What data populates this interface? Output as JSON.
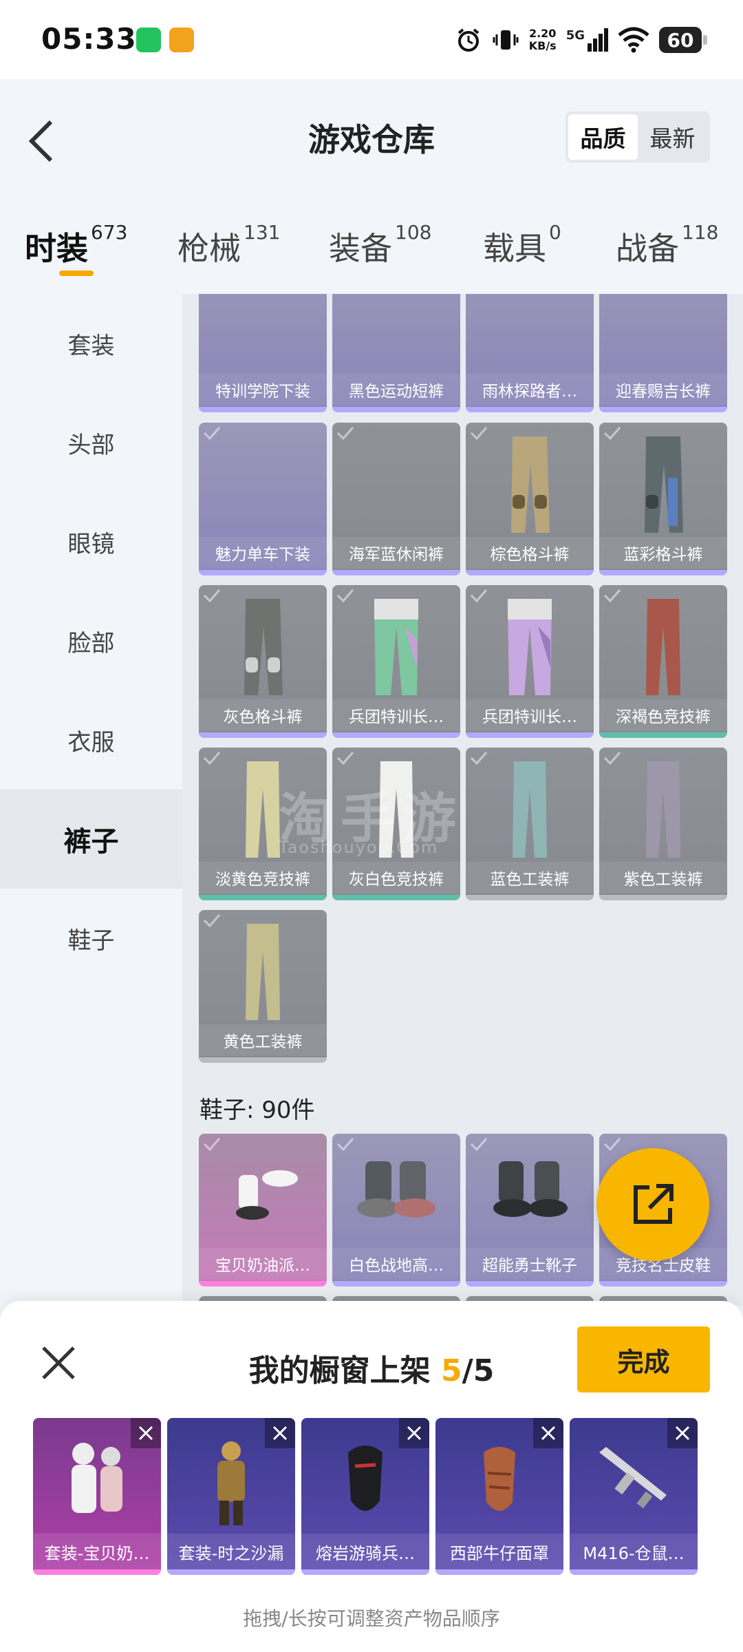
{
  "status": {
    "time": "05:33",
    "net_speed_value": "2.20",
    "net_speed_unit": "KB/s",
    "signal": "5G",
    "battery": "60"
  },
  "header": {
    "title": "游戏仓库",
    "sort_options": [
      "品质",
      "最新"
    ],
    "active_sort": "品质"
  },
  "tabs": [
    {
      "label": "时装",
      "count": "673"
    },
    {
      "label": "枪械",
      "count": "131"
    },
    {
      "label": "装备",
      "count": "108"
    },
    {
      "label": "载具",
      "count": "0"
    },
    {
      "label": "战备",
      "count": "118"
    }
  ],
  "sidebar": {
    "items": [
      "套装",
      "头部",
      "眼镜",
      "脸部",
      "衣服",
      "裤子",
      "鞋子"
    ],
    "active": "裤子"
  },
  "pants_items": [
    {
      "name": "特训学院下装",
      "rarity": "purple"
    },
    {
      "name": "黑色运动短裤",
      "rarity": "purple"
    },
    {
      "name": "雨林探路者…",
      "rarity": "purple"
    },
    {
      "name": "迎春赐吉长裤",
      "rarity": "purple"
    },
    {
      "name": "魅力单车下装",
      "rarity": "purple"
    },
    {
      "name": "海军蓝休闲裤",
      "rarity": "purple"
    },
    {
      "name": "棕色格斗裤",
      "rarity": "purple"
    },
    {
      "name": "蓝彩格斗裤",
      "rarity": "purple"
    },
    {
      "name": "灰色格斗裤",
      "rarity": "purple"
    },
    {
      "name": "兵团特训长…",
      "rarity": "purple"
    },
    {
      "name": "兵团特训长…",
      "rarity": "purple"
    },
    {
      "name": "深褐色竞技裤",
      "rarity": "teal"
    },
    {
      "name": "淡黄色竞技裤",
      "rarity": "teal"
    },
    {
      "name": "灰白色竞技裤",
      "rarity": "teal"
    },
    {
      "name": "蓝色工装裤",
      "rarity": "gray"
    },
    {
      "name": "紫色工装裤",
      "rarity": "gray"
    },
    {
      "name": "黄色工装裤",
      "rarity": "gray"
    }
  ],
  "shoes_section": {
    "title": "鞋子: 90件",
    "items": [
      {
        "name": "宝贝奶油派…",
        "rarity": "pink"
      },
      {
        "name": "白色战地高…",
        "rarity": "purple"
      },
      {
        "name": "超能勇士靴子",
        "rarity": "purple"
      },
      {
        "name": "竞技名士皮鞋",
        "rarity": "purple"
      }
    ]
  },
  "watermark": {
    "main": "淘手游",
    "sub": "Taoshouyou.Com"
  },
  "showcase": {
    "title_prefix": "我的橱窗上架",
    "current": "5",
    "total": "/5",
    "done_label": "完成",
    "items": [
      {
        "name": "套装-宝贝奶…",
        "rarity": "pink"
      },
      {
        "name": "套装-时之沙漏",
        "rarity": "purple"
      },
      {
        "name": "熔岩游骑兵…",
        "rarity": "purple"
      },
      {
        "name": "西部牛仔面罩",
        "rarity": "purple"
      },
      {
        "name": "M416-仓鼠…",
        "rarity": "purple"
      }
    ],
    "hint": "拖拽/长按可调整资产物品顺序"
  },
  "colors": {
    "accent": "#f8b600",
    "purple_rarity": "#b4a8ff",
    "teal_rarity": "#5fbfaa",
    "pink_rarity": "#ff7fe0"
  }
}
